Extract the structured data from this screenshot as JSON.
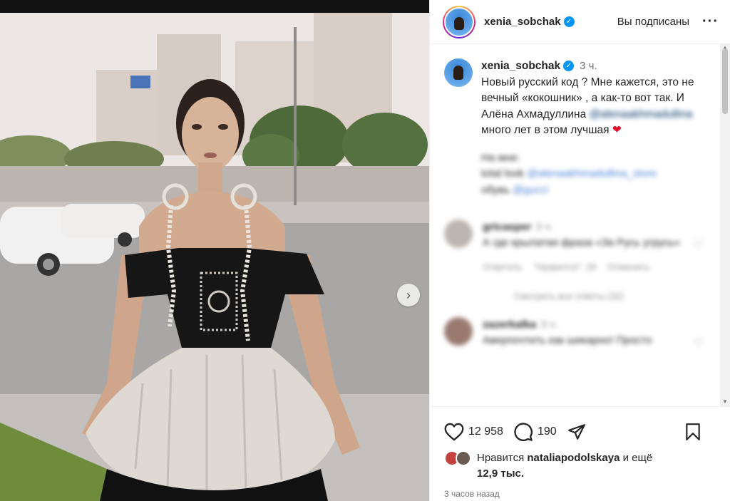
{
  "post": {
    "username": "xenia_sobchak",
    "follow_status": "Вы подписаны",
    "more_icon": "more-horizontal-icon"
  },
  "caption": {
    "username": "xenia_sobchak",
    "time": "3 ч.",
    "text_part1": "Новый русский код ? Мне кажется, это не вечный «кокошник» , а как-то вот так. И Алёна Ахмадуллина",
    "mention": "@alenaakhmadullina",
    "text_part2": "много лет в этом лучшая",
    "emoji": "❤️"
  },
  "credits": {
    "line1": "На мне:",
    "line2_prefix": "total look",
    "line2_link": "@alenaakhmadullina_store",
    "line3_prefix": "обувь",
    "line3_link": "@gucci"
  },
  "comments": [
    {
      "username": "grtcasper",
      "time": "3 ч.",
      "text": "А где крылатая фраза «За Русь угрусь»",
      "meta_reply": "Ответить",
      "meta_likes": "\"Нравится\": 29",
      "meta_cancel": "Отменить"
    },
    {
      "username": "zazerkalka",
      "time": "3 ч.",
      "text": "Аверпочтить как шикарно! Просто"
    }
  ],
  "view_replies": "Смотреть все ответы (32)",
  "stats": {
    "likes": "12 958",
    "comments": "190"
  },
  "liked_by": {
    "prefix": "Нравится",
    "user": "nataliapodolskaya",
    "suffix": "и ещё",
    "count": "12,9 тыс."
  },
  "time_ago": "3 часов назад",
  "colors": {
    "link": "#00376b",
    "verified": "#0095f6",
    "heart": "#e0112b"
  }
}
